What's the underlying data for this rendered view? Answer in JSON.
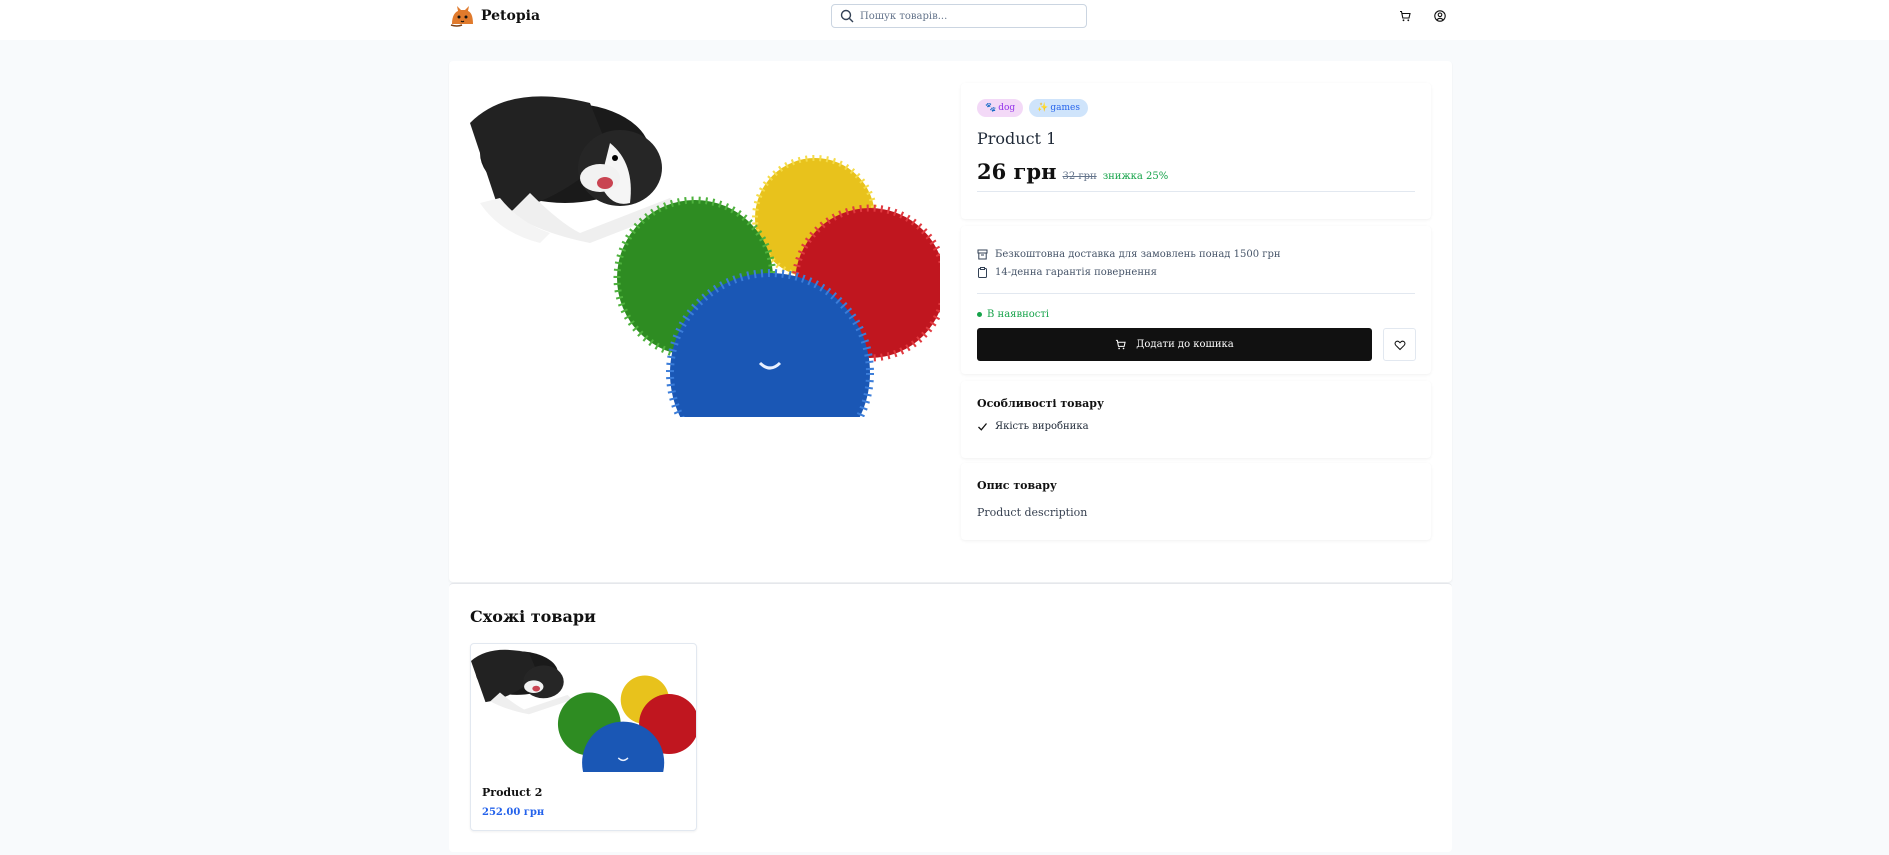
{
  "header": {
    "brand": "Petopia",
    "search_placeholder": "Пошук товарів..."
  },
  "product": {
    "tags": [
      {
        "icon": "paw-icon",
        "label": "dog"
      },
      {
        "icon": "sparkles-icon",
        "label": "games"
      }
    ],
    "title": "Product 1",
    "price": "26 грн",
    "old_price": "32 грн",
    "discount": "знижка 25%",
    "perks": [
      {
        "icon": "box-icon",
        "label": "Безкоштовна доставка для замовлень понад 1500 грн"
      },
      {
        "icon": "clipboard-icon",
        "label": "14-денна гарантія повернення"
      }
    ],
    "stock": "В наявності",
    "add_to_cart": "Додати до кошика",
    "features_title": "Особливості товару",
    "features": [
      "Якість виробника"
    ],
    "description_title": "Опис товару",
    "description": "Product description"
  },
  "similar": {
    "title": "Схожі товари",
    "items": [
      {
        "name": "Product 2",
        "price": "252.00 грн"
      }
    ]
  },
  "colors": {
    "accent_dark": "#111111",
    "in_stock_green": "#16a34a",
    "price_blue": "#2563eb",
    "tag_dog_bg": "#f3d9f7",
    "tag_games_bg": "#cfe4fb"
  }
}
